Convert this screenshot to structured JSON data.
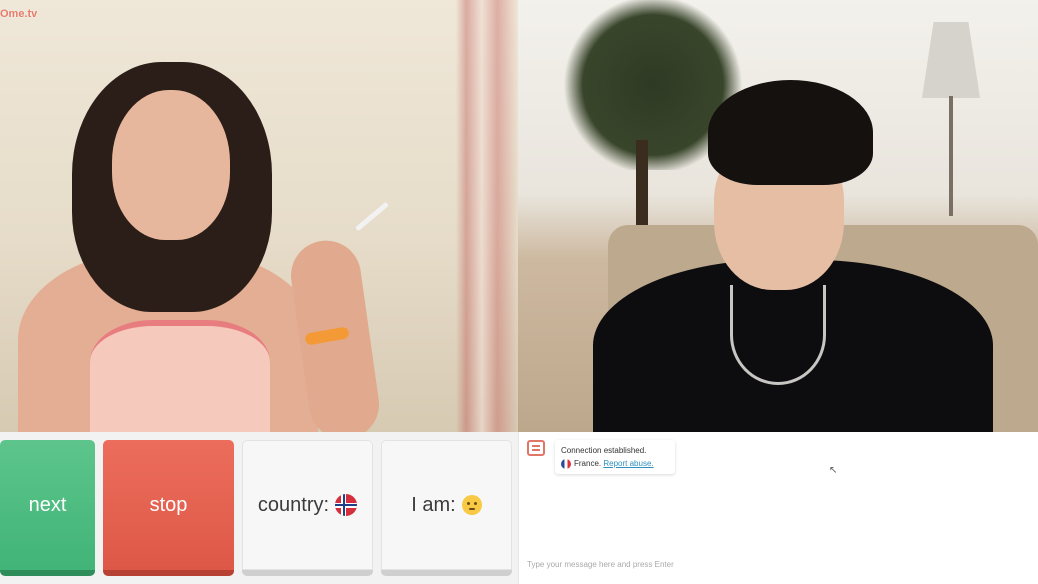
{
  "site": {
    "logo_text": "Ome.tv"
  },
  "controls": {
    "next_label": "next",
    "stop_label": "stop",
    "country_label": "country:",
    "country_flag": "norway-flag-icon",
    "iam_label": "I am:",
    "iam_icon": "neutral-face-emoji-icon"
  },
  "chat": {
    "system_message": {
      "status": "Connection established.",
      "country": "France.",
      "report_link": "Report abuse."
    },
    "input_placeholder": "Type your message here and press Enter"
  },
  "colors": {
    "next": "#41b477",
    "stop": "#de5847",
    "link": "#2f8fbf"
  }
}
